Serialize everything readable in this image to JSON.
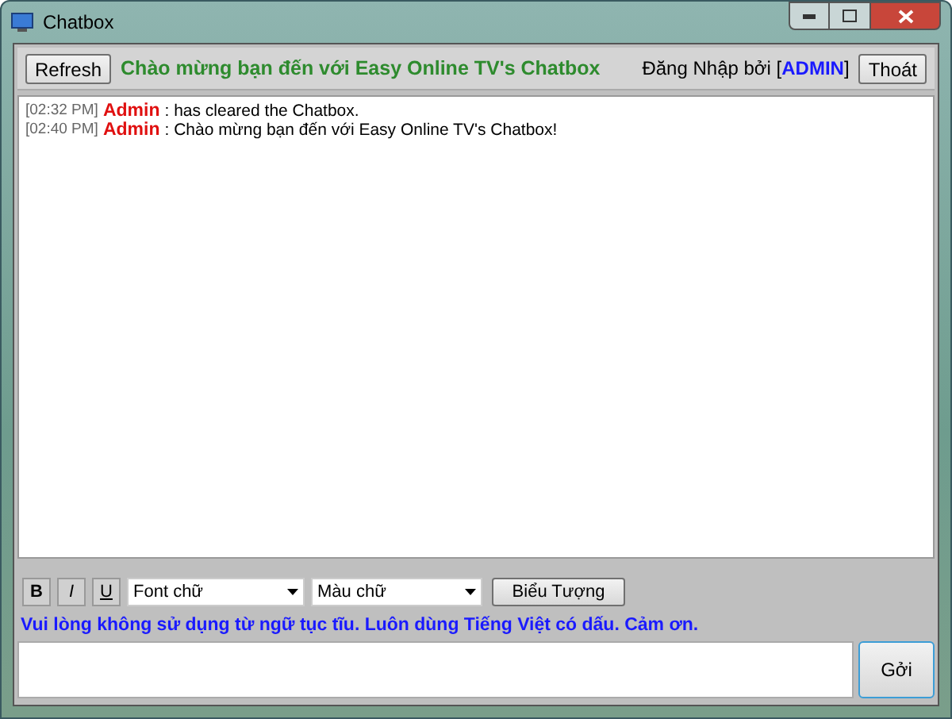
{
  "window": {
    "title": "Chatbox"
  },
  "header": {
    "refresh_button": "Refresh",
    "welcome": "Chào mừng bạn đến với Easy Online TV's Chatbox",
    "login_label": "Đăng Nhập bởi [",
    "login_user": "ADMIN",
    "login_end": "]",
    "logout_button": "Thoát"
  },
  "messages": [
    {
      "time": "[02:32 PM]",
      "user": "Admin",
      "text": ": has cleared the Chatbox."
    },
    {
      "time": "[02:40 PM]",
      "user": "Admin",
      "text": ": Chào mừng bạn đến với Easy Online TV's Chatbox!"
    }
  ],
  "toolbar": {
    "format_buttons": [
      "B",
      "I",
      "U"
    ],
    "font_select": "Font chữ",
    "color_select": "Màu chữ",
    "emoticon_button": "Biểu Tượng"
  },
  "notice": "Vui lòng không sử dụng từ ngữ tục tĩu. Luôn dùng Tiếng Việt có dấu. Cảm ơn.",
  "send_button": "Gởi"
}
